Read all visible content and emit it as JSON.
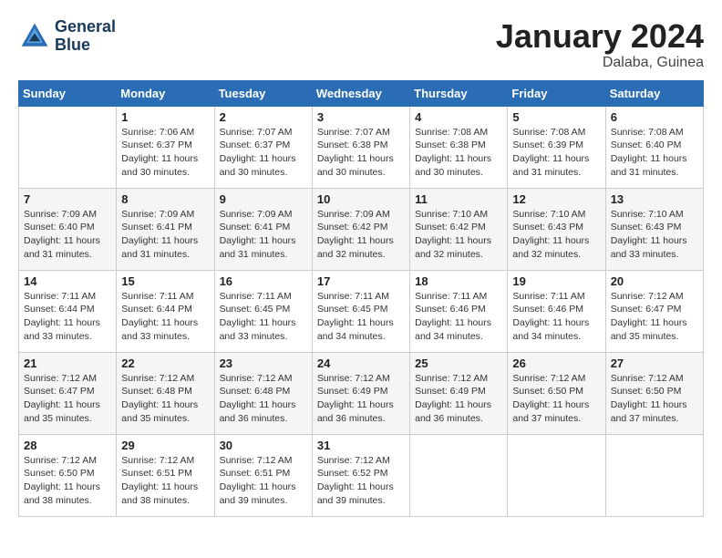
{
  "header": {
    "logo_line1": "General",
    "logo_line2": "Blue",
    "month_title": "January 2024",
    "subtitle": "Dalaba, Guinea"
  },
  "weekdays": [
    "Sunday",
    "Monday",
    "Tuesday",
    "Wednesday",
    "Thursday",
    "Friday",
    "Saturday"
  ],
  "weeks": [
    [
      {
        "day": "",
        "info": ""
      },
      {
        "day": "1",
        "info": "Sunrise: 7:06 AM\nSunset: 6:37 PM\nDaylight: 11 hours\nand 30 minutes."
      },
      {
        "day": "2",
        "info": "Sunrise: 7:07 AM\nSunset: 6:37 PM\nDaylight: 11 hours\nand 30 minutes."
      },
      {
        "day": "3",
        "info": "Sunrise: 7:07 AM\nSunset: 6:38 PM\nDaylight: 11 hours\nand 30 minutes."
      },
      {
        "day": "4",
        "info": "Sunrise: 7:08 AM\nSunset: 6:38 PM\nDaylight: 11 hours\nand 30 minutes."
      },
      {
        "day": "5",
        "info": "Sunrise: 7:08 AM\nSunset: 6:39 PM\nDaylight: 11 hours\nand 31 minutes."
      },
      {
        "day": "6",
        "info": "Sunrise: 7:08 AM\nSunset: 6:40 PM\nDaylight: 11 hours\nand 31 minutes."
      }
    ],
    [
      {
        "day": "7",
        "info": "Sunrise: 7:09 AM\nSunset: 6:40 PM\nDaylight: 11 hours\nand 31 minutes."
      },
      {
        "day": "8",
        "info": "Sunrise: 7:09 AM\nSunset: 6:41 PM\nDaylight: 11 hours\nand 31 minutes."
      },
      {
        "day": "9",
        "info": "Sunrise: 7:09 AM\nSunset: 6:41 PM\nDaylight: 11 hours\nand 31 minutes."
      },
      {
        "day": "10",
        "info": "Sunrise: 7:09 AM\nSunset: 6:42 PM\nDaylight: 11 hours\nand 32 minutes."
      },
      {
        "day": "11",
        "info": "Sunrise: 7:10 AM\nSunset: 6:42 PM\nDaylight: 11 hours\nand 32 minutes."
      },
      {
        "day": "12",
        "info": "Sunrise: 7:10 AM\nSunset: 6:43 PM\nDaylight: 11 hours\nand 32 minutes."
      },
      {
        "day": "13",
        "info": "Sunrise: 7:10 AM\nSunset: 6:43 PM\nDaylight: 11 hours\nand 33 minutes."
      }
    ],
    [
      {
        "day": "14",
        "info": "Sunrise: 7:11 AM\nSunset: 6:44 PM\nDaylight: 11 hours\nand 33 minutes."
      },
      {
        "day": "15",
        "info": "Sunrise: 7:11 AM\nSunset: 6:44 PM\nDaylight: 11 hours\nand 33 minutes."
      },
      {
        "day": "16",
        "info": "Sunrise: 7:11 AM\nSunset: 6:45 PM\nDaylight: 11 hours\nand 33 minutes."
      },
      {
        "day": "17",
        "info": "Sunrise: 7:11 AM\nSunset: 6:45 PM\nDaylight: 11 hours\nand 34 minutes."
      },
      {
        "day": "18",
        "info": "Sunrise: 7:11 AM\nSunset: 6:46 PM\nDaylight: 11 hours\nand 34 minutes."
      },
      {
        "day": "19",
        "info": "Sunrise: 7:11 AM\nSunset: 6:46 PM\nDaylight: 11 hours\nand 34 minutes."
      },
      {
        "day": "20",
        "info": "Sunrise: 7:12 AM\nSunset: 6:47 PM\nDaylight: 11 hours\nand 35 minutes."
      }
    ],
    [
      {
        "day": "21",
        "info": "Sunrise: 7:12 AM\nSunset: 6:47 PM\nDaylight: 11 hours\nand 35 minutes."
      },
      {
        "day": "22",
        "info": "Sunrise: 7:12 AM\nSunset: 6:48 PM\nDaylight: 11 hours\nand 35 minutes."
      },
      {
        "day": "23",
        "info": "Sunrise: 7:12 AM\nSunset: 6:48 PM\nDaylight: 11 hours\nand 36 minutes."
      },
      {
        "day": "24",
        "info": "Sunrise: 7:12 AM\nSunset: 6:49 PM\nDaylight: 11 hours\nand 36 minutes."
      },
      {
        "day": "25",
        "info": "Sunrise: 7:12 AM\nSunset: 6:49 PM\nDaylight: 11 hours\nand 36 minutes."
      },
      {
        "day": "26",
        "info": "Sunrise: 7:12 AM\nSunset: 6:50 PM\nDaylight: 11 hours\nand 37 minutes."
      },
      {
        "day": "27",
        "info": "Sunrise: 7:12 AM\nSunset: 6:50 PM\nDaylight: 11 hours\nand 37 minutes."
      }
    ],
    [
      {
        "day": "28",
        "info": "Sunrise: 7:12 AM\nSunset: 6:50 PM\nDaylight: 11 hours\nand 38 minutes."
      },
      {
        "day": "29",
        "info": "Sunrise: 7:12 AM\nSunset: 6:51 PM\nDaylight: 11 hours\nand 38 minutes."
      },
      {
        "day": "30",
        "info": "Sunrise: 7:12 AM\nSunset: 6:51 PM\nDaylight: 11 hours\nand 39 minutes."
      },
      {
        "day": "31",
        "info": "Sunrise: 7:12 AM\nSunset: 6:52 PM\nDaylight: 11 hours\nand 39 minutes."
      },
      {
        "day": "",
        "info": ""
      },
      {
        "day": "",
        "info": ""
      },
      {
        "day": "",
        "info": ""
      }
    ]
  ]
}
